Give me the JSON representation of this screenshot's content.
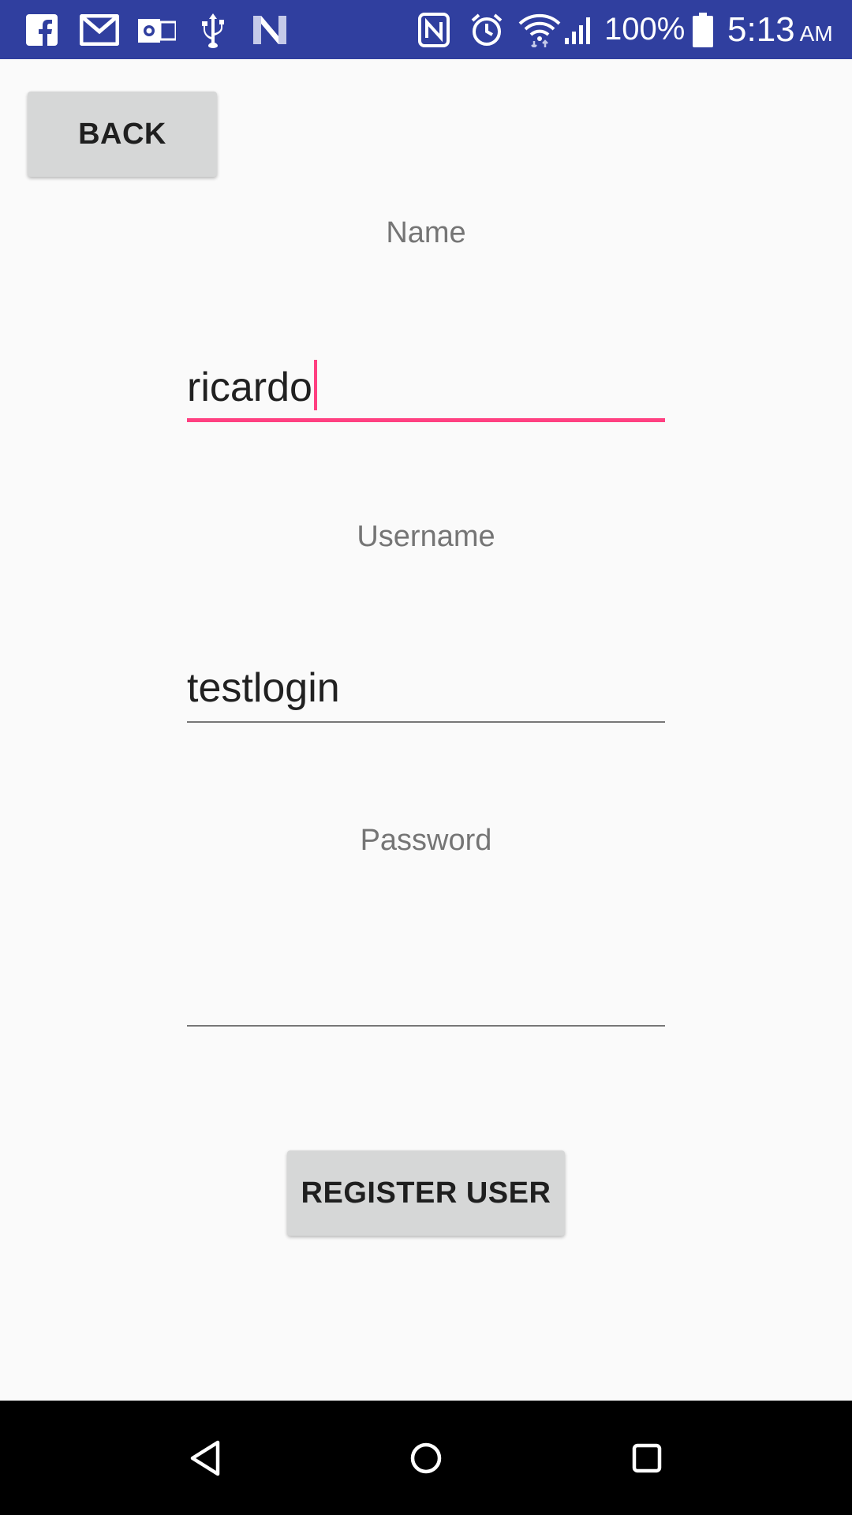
{
  "status_bar": {
    "icons_left": [
      "facebook-icon",
      "gmail-icon",
      "outlook-icon",
      "usb-icon",
      "n-app-icon"
    ],
    "icons_right": [
      "nfc-icon",
      "alarm-icon",
      "wifi-icon",
      "signal-icon",
      "battery-icon"
    ],
    "battery": "100%",
    "time": "5:13",
    "ampm": "AM",
    "background_color": "#303f9f"
  },
  "toolbar": {
    "back_label": "BACK"
  },
  "form": {
    "name": {
      "label": "Name",
      "value": "ricardo",
      "focused": true
    },
    "username": {
      "label": "Username",
      "value": "testlogin"
    },
    "password": {
      "label": "Password",
      "value": ""
    },
    "register_label": "REGISTER USER",
    "accent_color": "#ff4081"
  },
  "nav_bar": {
    "buttons": [
      "back-nav-icon",
      "home-nav-icon",
      "recents-nav-icon"
    ]
  }
}
